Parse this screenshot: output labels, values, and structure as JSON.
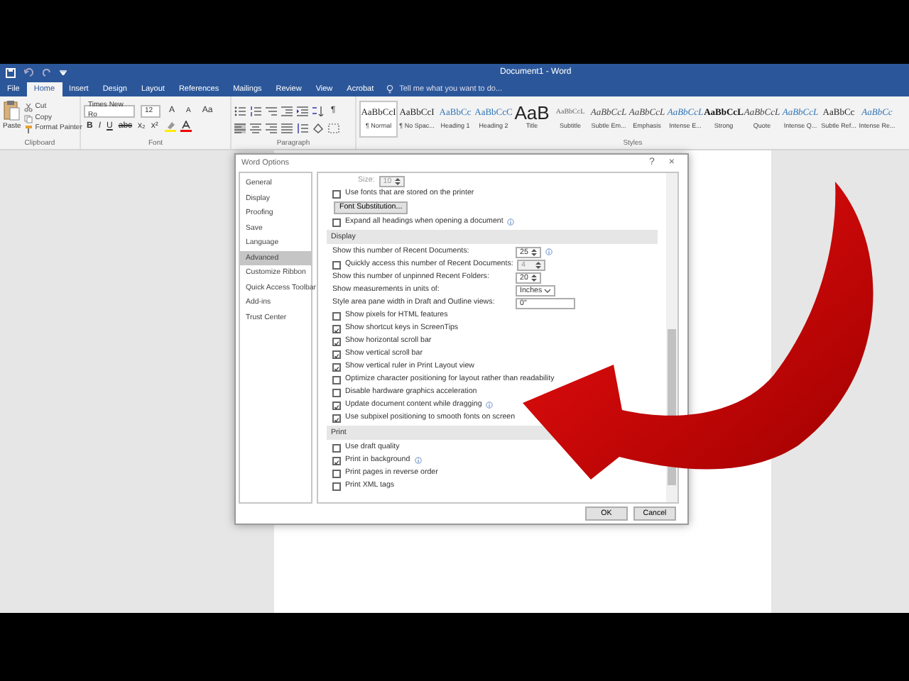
{
  "title_bar": {
    "title": "Document1 - Word"
  },
  "ribbon_tabs": [
    {
      "label": "File",
      "selected": false
    },
    {
      "label": "Home",
      "selected": true
    },
    {
      "label": "Insert",
      "selected": false
    },
    {
      "label": "Design",
      "selected": false
    },
    {
      "label": "Layout",
      "selected": false
    },
    {
      "label": "References",
      "selected": false
    },
    {
      "label": "Mailings",
      "selected": false
    },
    {
      "label": "Review",
      "selected": false
    },
    {
      "label": "View",
      "selected": false
    },
    {
      "label": "Acrobat",
      "selected": false
    }
  ],
  "tell_me": "Tell me what you want to do...",
  "clipboard": {
    "paste": "Paste",
    "cut": "Cut",
    "copy": "Copy",
    "format_painter": "Format Painter",
    "label": "Clipboard"
  },
  "font": {
    "name": "Times New Ro",
    "size": "12",
    "row1": [
      "A",
      "A",
      "Aa"
    ],
    "row2": [
      "B",
      "I",
      "U",
      "abc",
      "x₂",
      "x²"
    ],
    "label": "Font"
  },
  "paragraph": {
    "marks": "¶",
    "label": "Paragraph"
  },
  "styles": {
    "label": "Styles",
    "items": [
      {
        "preview": "AaBbCcI",
        "name": "¶ Normal",
        "kind": "body",
        "selected": true
      },
      {
        "preview": "AaBbCcI",
        "name": "¶ No Spac...",
        "kind": "body",
        "selected": false
      },
      {
        "preview": "AaBbCc",
        "name": "Heading 1",
        "kind": "heading",
        "selected": false
      },
      {
        "preview": "AaBbCcC",
        "name": "Heading 2",
        "kind": "heading",
        "selected": false
      },
      {
        "preview": "AaB",
        "name": "Title",
        "kind": "title",
        "selected": false
      },
      {
        "preview": "AaBbCcL",
        "name": "Subtitle",
        "kind": "subtle",
        "selected": false
      },
      {
        "preview": "AaBbCcL",
        "name": "Subtle Em...",
        "kind": "italic",
        "selected": false
      },
      {
        "preview": "AaBbCcL",
        "name": "Emphasis",
        "kind": "italic",
        "selected": false
      },
      {
        "preview": "AaBbCcL",
        "name": "Intense E...",
        "kind": "intense",
        "selected": false
      },
      {
        "preview": "AaBbCcL",
        "name": "Strong",
        "kind": "strong",
        "selected": false
      },
      {
        "preview": "AaBbCcL",
        "name": "Quote",
        "kind": "italic",
        "selected": false
      },
      {
        "preview": "AaBbCcL",
        "name": "Intense Q...",
        "kind": "intense",
        "selected": false
      },
      {
        "preview": "AaBbCc",
        "name": "Subtle Ref...",
        "kind": "body",
        "selected": false
      },
      {
        "preview": "AaBbCc",
        "name": "Intense Re...",
        "kind": "intense",
        "selected": false
      }
    ]
  },
  "dialog": {
    "title": "Word Options",
    "help": "?",
    "close": "×",
    "nav": [
      {
        "label": "General",
        "selected": false
      },
      {
        "label": "Display",
        "selected": false
      },
      {
        "label": "Proofing",
        "selected": false
      },
      {
        "label": "Save",
        "selected": false
      },
      {
        "label": "Language",
        "selected": false
      },
      {
        "label": "Advanced",
        "selected": true
      },
      {
        "label": "Customize Ribbon",
        "selected": false
      },
      {
        "label": "Quick Access Toolbar",
        "selected": false
      },
      {
        "label": "Add-ins",
        "selected": false
      },
      {
        "label": "Trust Center",
        "selected": false
      }
    ],
    "items": [
      {
        "kind": "spin",
        "label": "Size:",
        "value": "10",
        "disabled": true
      },
      {
        "kind": "checkbox",
        "label": "Use fonts that are stored on the printer",
        "checked": false
      },
      {
        "kind": "button",
        "label": "Font Substitution..."
      },
      {
        "kind": "checkbox",
        "label": "Expand all headings when opening a document",
        "checked": false,
        "info": true
      },
      {
        "kind": "section",
        "label": "Display"
      },
      {
        "kind": "spin",
        "label": "Show this number of Recent Documents:",
        "value": "25",
        "disabled": false,
        "info": true
      },
      {
        "kind": "checkspin",
        "label": "Quickly access this number of Recent Documents:",
        "checked": false,
        "value": "4",
        "disabled": true
      },
      {
        "kind": "spin",
        "label": "Show this number of unpinned Recent Folders:",
        "value": "20",
        "disabled": false
      },
      {
        "kind": "select",
        "label": "Show measurements in units of:",
        "value": "Inches",
        "disabled": false
      },
      {
        "kind": "text",
        "label": "Style area pane width in Draft and Outline views:",
        "value": "0\"",
        "disabled": false
      },
      {
        "kind": "checkbox",
        "label": "Show pixels for HTML features",
        "checked": false
      },
      {
        "kind": "checkbox",
        "label": "Show shortcut keys in ScreenTips",
        "checked": true
      },
      {
        "kind": "checkbox",
        "label": "Show horizontal scroll bar",
        "checked": true
      },
      {
        "kind": "checkbox",
        "label": "Show vertical scroll bar",
        "checked": true
      },
      {
        "kind": "checkbox",
        "label": "Show vertical ruler in Print Layout view",
        "checked": true
      },
      {
        "kind": "checkbox",
        "label": "Optimize character positioning for layout rather than readability",
        "checked": false
      },
      {
        "kind": "checkbox",
        "label": "Disable hardware graphics acceleration",
        "checked": false
      },
      {
        "kind": "checkbox",
        "label": "Update document content while dragging",
        "checked": true,
        "info": true
      },
      {
        "kind": "checkbox",
        "label": "Use subpixel positioning to smooth fonts on screen",
        "checked": true
      },
      {
        "kind": "section",
        "label": "Print"
      },
      {
        "kind": "checkbox",
        "label": "Use draft quality",
        "checked": false
      },
      {
        "kind": "checkbox",
        "label": "Print in background",
        "checked": true,
        "info": true
      },
      {
        "kind": "checkbox",
        "label": "Print pages in reverse order",
        "checked": false
      },
      {
        "kind": "checkbox",
        "label": "Print XML tags",
        "checked": false
      }
    ],
    "buttons": [
      "OK",
      "Cancel"
    ]
  }
}
